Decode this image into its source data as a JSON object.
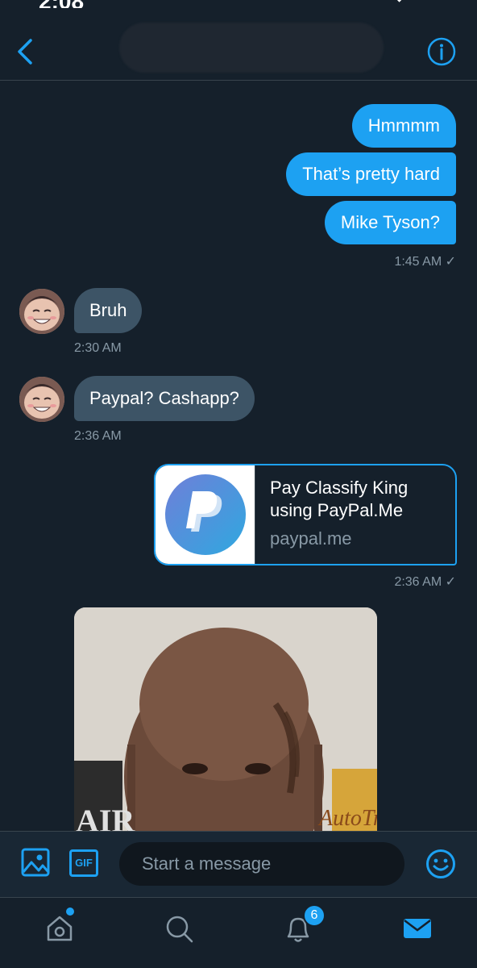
{
  "status_bar": {
    "time": "2:08"
  },
  "conversation": {
    "outgoing_messages": [
      "Hmmmm",
      "That’s pretty hard",
      "Mike Tyson?"
    ],
    "outgoing_time_1": "1:45 AM ✓",
    "incoming": [
      {
        "text": "Bruh",
        "time": "2:30 AM"
      },
      {
        "text": "Paypal? Cashapp?",
        "time": "2:36 AM"
      }
    ],
    "link_card": {
      "title": "Pay Classify King using PayPal.Me",
      "domain": "paypal.me",
      "time": "2:36 AM ✓"
    },
    "photo": {
      "sign_text_left": "AIR",
      "sign_text_right": "AutoTr"
    }
  },
  "composer": {
    "gif_label": "GIF",
    "placeholder": "Start a message"
  },
  "tabbar": {
    "notifications_badge": "6"
  },
  "colors": {
    "accent": "#1da1f2",
    "background": "#15202b",
    "incoming_bubble": "#3d5466",
    "muted_text": "#8899a6"
  },
  "icons": {
    "back": "chevron-left-icon",
    "info": "info-icon",
    "media": "image-icon",
    "emoji": "smiley-icon",
    "home": "home-icon",
    "search": "search-icon",
    "notifications": "bell-icon",
    "messages": "mail-icon"
  }
}
